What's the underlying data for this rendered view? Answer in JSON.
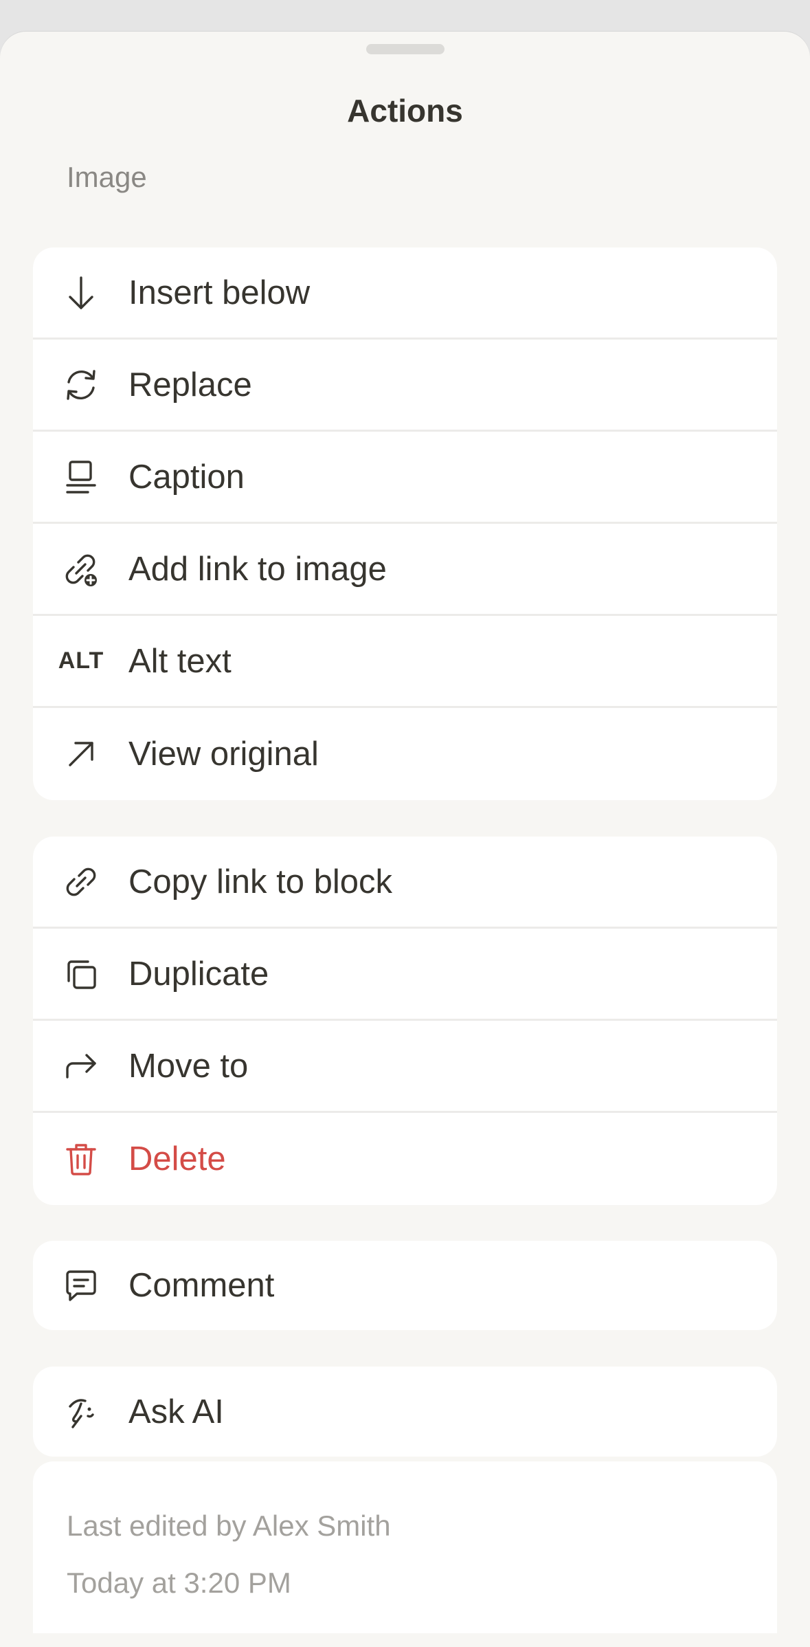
{
  "sheet": {
    "title": "Actions"
  },
  "section": {
    "label": "Image"
  },
  "groups": {
    "image_actions": [
      {
        "label": "Insert below",
        "icon": "arrow-down-icon"
      },
      {
        "label": "Replace",
        "icon": "refresh-icon"
      },
      {
        "label": "Caption",
        "icon": "caption-icon"
      },
      {
        "label": "Add link to image",
        "icon": "link-add-icon"
      },
      {
        "label": "Alt text",
        "icon": "alt-text-icon",
        "icon_text": "ALT"
      },
      {
        "label": "View original",
        "icon": "arrow-up-right-icon"
      }
    ],
    "block_actions": [
      {
        "label": "Copy link to block",
        "icon": "link-icon"
      },
      {
        "label": "Duplicate",
        "icon": "duplicate-icon"
      },
      {
        "label": "Move to",
        "icon": "move-arrow-icon"
      },
      {
        "label": "Delete",
        "icon": "trash-icon"
      }
    ],
    "comment": [
      {
        "label": "Comment",
        "icon": "comment-icon"
      }
    ],
    "ai": [
      {
        "label": "Ask AI",
        "icon": "ai-face-icon"
      }
    ]
  },
  "meta": {
    "edited_by": "Last edited by Alex Smith",
    "edited_at": "Today at 3:20 PM"
  },
  "colors": {
    "sheet_bg": "#f7f6f3",
    "text": "#37352f",
    "danger": "#d44c47",
    "muted": "#8a8884"
  }
}
